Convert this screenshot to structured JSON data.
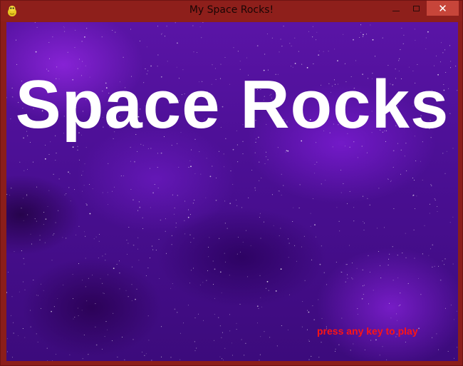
{
  "window": {
    "title": "My Space Rocks!",
    "app_icon": "pygame-snake-icon",
    "controls": {
      "minimize_icon": "minimize-icon",
      "maximize_icon": "maximize-icon",
      "close_glyph": "✕"
    },
    "frame_color": "#8e1f1b",
    "close_color": "#c7453a"
  },
  "game": {
    "title": "Space Rocks",
    "prompt": "press any key to play",
    "title_color": "#ffffff",
    "prompt_color": "#ff1414",
    "background": "purple-nebula-starfield"
  }
}
